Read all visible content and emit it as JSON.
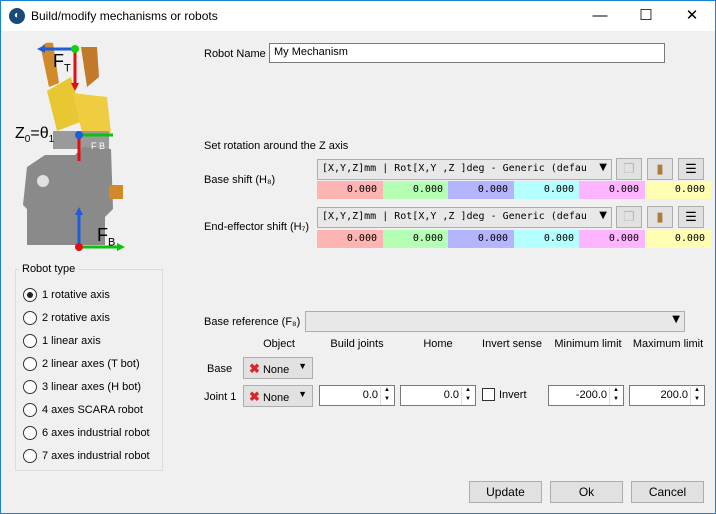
{
  "window": {
    "title": "Build/modify mechanisms or robots",
    "minimize": "—",
    "maximize": "☐",
    "close": "✕"
  },
  "image": {
    "ft": "F",
    "ft_sub": "T",
    "z0": "Z",
    "z0_sub": "0",
    "theta": "θ",
    "theta_sub": "1",
    "fb": "F",
    "fb_sub": "B",
    "overlay": "F B"
  },
  "robot_name": {
    "label": "Robot Name",
    "value": "My Mechanism"
  },
  "rotation": {
    "label": "Set rotation around the Z axis"
  },
  "base_shift": {
    "label": "Base shift (H₈)",
    "combo": "[X,Y,Z]mm | Rot[X,Y ,Z  ]deg - Generic (defau",
    "values": [
      "0.000",
      "0.000",
      "0.000",
      "0.000",
      "0.000",
      "0.000"
    ]
  },
  "ee_shift": {
    "label": "End-effector shift (H₇)",
    "combo": "[X,Y,Z]mm | Rot[X,Y ,Z  ]deg - Generic (defau",
    "values": [
      "0.000",
      "0.000",
      "0.000",
      "0.000",
      "0.000",
      "0.000"
    ]
  },
  "cell_colors": [
    "#ffb4b4",
    "#b4ffb4",
    "#b4b4ff",
    "#b4ffff",
    "#ffb4ff",
    "#ffffb4"
  ],
  "robot_type": {
    "title": "Robot type",
    "options": [
      "1 rotative axis",
      "2 rotative axis",
      "1 linear axis",
      "2 linear axes (T bot)",
      "3 linear axes (H bot)",
      "4 axes SCARA robot",
      "6 axes industrial robot",
      "7 axes industrial robot"
    ],
    "selected": "1 rotative axis"
  },
  "base_reference": {
    "label": "Base reference (F₈)",
    "value": ""
  },
  "joints": {
    "headers": {
      "object": "Object",
      "build": "Build joints",
      "home": "Home",
      "invert": "Invert sense",
      "min": "Minimum limit",
      "max": "Maximum limit"
    },
    "base_label": "Base",
    "base_object": "None",
    "joint1": {
      "label": "Joint 1",
      "object": "None",
      "build": "0.0",
      "home": "0.0",
      "invert_label": "Invert",
      "invert": false,
      "min": "-200.0",
      "max": "200.0"
    }
  },
  "buttons": {
    "update": "Update",
    "ok": "Ok",
    "cancel": "Cancel"
  },
  "icons": {
    "copy": "copy-icon",
    "paste": "paste-icon",
    "menu": "menu-icon"
  }
}
